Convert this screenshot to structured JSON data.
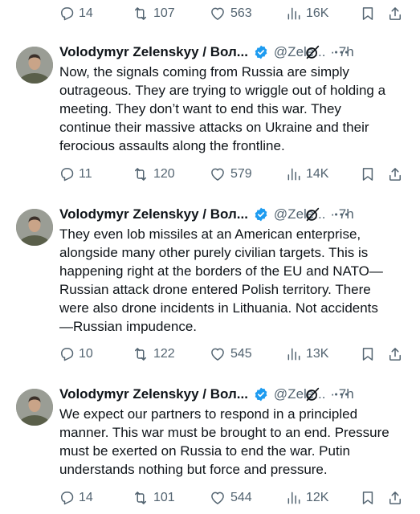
{
  "top_actions": {
    "replies": "14",
    "reposts": "107",
    "likes": "563",
    "views": "16K"
  },
  "tweets": [
    {
      "name": "Volodymyr Zelenskyy / Вол...",
      "handle": "@Zele...",
      "time": "· 7h",
      "lines": [
        "Now, the signals coming from Russia are simply",
        "outrageous. They are trying to wriggle out of holding a",
        "meeting. They don’t want to end this war. They",
        "continue their massive attacks on Ukraine and their",
        "ferocious assaults along the frontline."
      ],
      "actions": {
        "replies": "11",
        "reposts": "120",
        "likes": "579",
        "views": "14K"
      }
    },
    {
      "name": "Volodymyr Zelenskyy / Вол...",
      "handle": "@Zele...",
      "time": "· 7h",
      "lines": [
        "They even lob missiles at an American enterprise,",
        "alongside many other purely civilian targets. This is",
        "happening right at the borders of the EU and NATO—",
        "Russian attack drone entered Polish territory. There",
        "were also drone incidents in Lithuania. Not accidents",
        "—Russian impudence."
      ],
      "actions": {
        "replies": "10",
        "reposts": "122",
        "likes": "545",
        "views": "13K"
      }
    },
    {
      "name": "Volodymyr Zelenskyy / Вол...",
      "handle": "@Zele...",
      "time": "· 7h",
      "lines": [
        "We expect our partners to respond in a principled",
        "manner. This war must be brought to an end. Pressure",
        "must be exerted on Russia to end the war. Putin",
        "understands nothing but force and pressure."
      ],
      "actions": {
        "replies": "14",
        "reposts": "101",
        "likes": "544",
        "views": "12K"
      }
    }
  ],
  "icons": {
    "reply": "reply-icon",
    "repost": "repost-icon",
    "like": "heart-icon",
    "views": "views-icon",
    "bookmark": "bookmark-icon",
    "share": "share-icon",
    "verified": "verified-badge-icon",
    "grok": "grok-icon",
    "more": "more-icon"
  },
  "colors": {
    "text": "#0f1419",
    "secondary": "#536471",
    "verified": "#1d9bf0"
  }
}
